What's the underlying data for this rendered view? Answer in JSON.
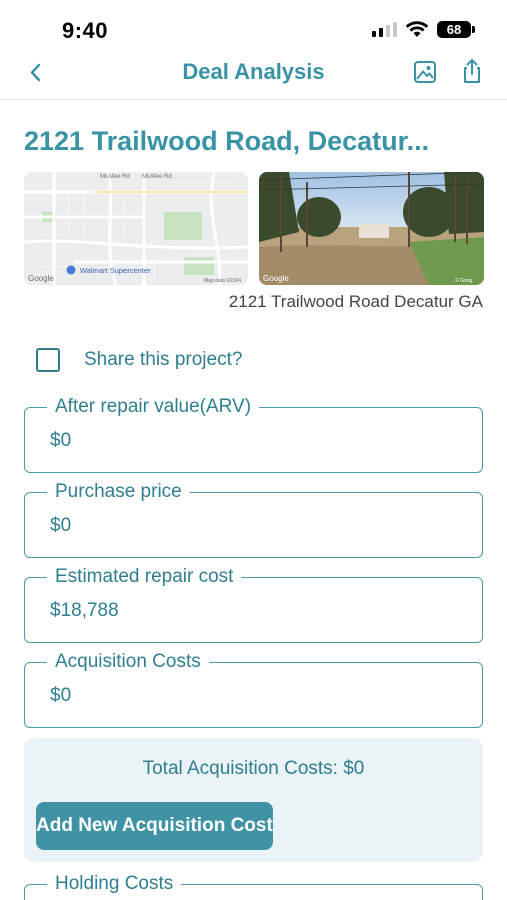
{
  "status_bar": {
    "time": "9:40",
    "battery": "68"
  },
  "nav": {
    "title": "Deal Analysis",
    "back_icon": "chevron-left-icon",
    "image_icon": "photo-icon",
    "share_icon": "share-icon"
  },
  "property": {
    "title": "2121 Trailwood Road, Decatur...",
    "caption": "2121 Trailwood Road Decatur GA",
    "map": {
      "labels": [
        "McAfee Rd",
        "McAfee Rd",
        "Walmart Supercenter",
        "Google",
        "Map data ©2024"
      ]
    },
    "street_view": {
      "labels": [
        "Google",
        "© Goog"
      ]
    }
  },
  "share": {
    "label": "Share this project?",
    "checked": false
  },
  "fields": [
    {
      "label": "After repair value(ARV)",
      "value": "$0"
    },
    {
      "label": "Purchase price",
      "value": "$0"
    },
    {
      "label": "Estimated repair cost",
      "value": "$18,788"
    },
    {
      "label": "Acquisition Costs",
      "value": "$0"
    }
  ],
  "acquisition_summary": {
    "total_text": "Total Acquisition Costs: $0",
    "add_button_label": "Add New Acquisition Cost"
  },
  "holding": {
    "label": "Holding Costs"
  },
  "colors": {
    "accent": "#3a93a4",
    "panel": "#eaf3f6",
    "button": "#3f93a4"
  }
}
